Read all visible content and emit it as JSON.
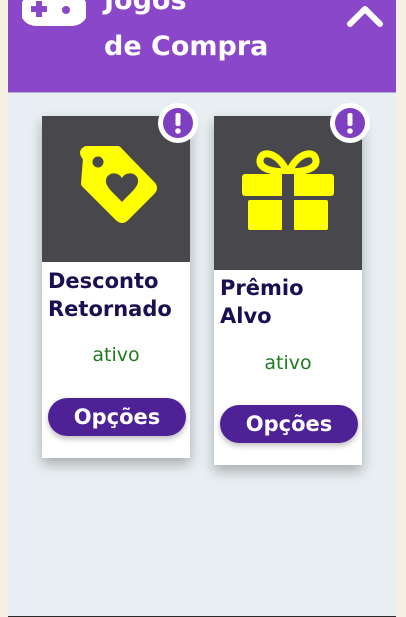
{
  "header": {
    "title_line1": "Jogos",
    "title_line2": "de Compra",
    "left_icon": "gamepad-icon",
    "right_icon": "chevron-up-icon"
  },
  "colors": {
    "header_bg": "#8a47c9",
    "card_image_bg": "#48484c",
    "icon_yellow": "#ffff00",
    "button_bg": "#4e2296",
    "status_green": "#1f7a1f",
    "title_navy": "#1b0f52",
    "badge_purple": "#7e3fc0"
  },
  "cards": [
    {
      "title_line1": "Desconto",
      "title_line2": "Retornado",
      "icon": "heart-tag-icon",
      "status": "ativo",
      "button_label": "Opções",
      "badge": "!"
    },
    {
      "title_line1": "Prêmio",
      "title_line2": "Alvo",
      "icon": "gift-icon",
      "status": "ativo",
      "button_label": "Opções",
      "badge": "!"
    }
  ]
}
